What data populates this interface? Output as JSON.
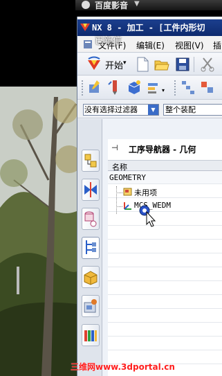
{
  "player": {
    "title": "百度影音",
    "arrow": "▼"
  },
  "window": {
    "title": "NX 8 - 加工 - [工件内形切",
    "overlay_caption": "已新信"
  },
  "menu": {
    "file": "文件(F)",
    "edit": "编辑(E)",
    "view": "视图(V)",
    "insert": "插"
  },
  "toolbar": {
    "start_label": "开始",
    "start_caret": "▾"
  },
  "filters": {
    "selection_filter": "没有选择过滤器",
    "selection_dropdown": "▼",
    "assembly_scope": "整个装配"
  },
  "navigator": {
    "pin_glyph": "⊣",
    "title": "工序导航器 - 几何",
    "column_name": "名称",
    "rows": [
      {
        "label": "GEOMETRY"
      },
      {
        "label": "未用项"
      },
      {
        "label": "MCS_WEDM"
      }
    ]
  },
  "watermark": "三维网www.3dportal.cn",
  "colors": {
    "title_bar": "#0d2a6e",
    "watermark": "#ff1e1e"
  }
}
